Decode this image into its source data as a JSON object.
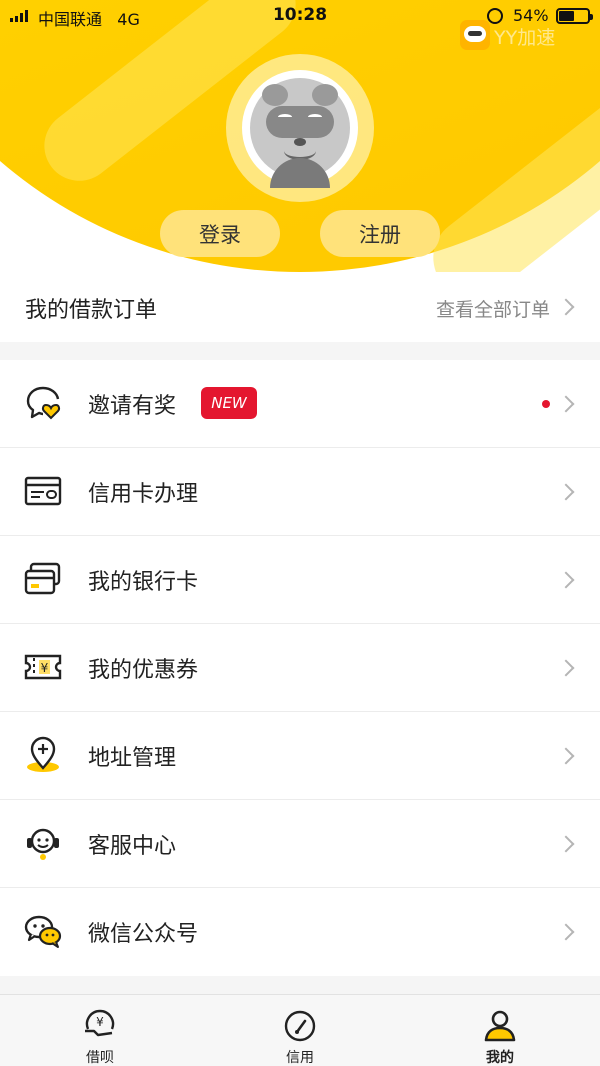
{
  "status_bar": {
    "carrier": "中国联通",
    "network": "4G",
    "time": "10:28",
    "battery": "54%",
    "battery_level": 0.54
  },
  "header": {
    "watermark": "YY加速",
    "login_label": "登录",
    "register_label": "注册"
  },
  "orders": {
    "title": "我的借款订单",
    "view_all": "查看全部订单"
  },
  "menu": {
    "items": [
      {
        "label": "邀请有奖",
        "icon": "invite-heart-icon",
        "badge": "NEW"
      },
      {
        "label": "信用卡办理",
        "icon": "credit-card-icon"
      },
      {
        "label": "我的银行卡",
        "icon": "bank-card-icon"
      },
      {
        "label": "我的优惠券",
        "icon": "coupon-icon"
      },
      {
        "label": "地址管理",
        "icon": "location-pin-icon"
      },
      {
        "label": "客服中心",
        "icon": "customer-service-icon"
      },
      {
        "label": "微信公众号",
        "icon": "wechat-icon"
      }
    ]
  },
  "tabbar": {
    "tabs": [
      {
        "label": "借呗",
        "icon": "loan-icon"
      },
      {
        "label": "信用",
        "icon": "credit-gauge-icon"
      },
      {
        "label": "我的",
        "icon": "profile-icon",
        "active": true
      }
    ]
  },
  "colors": {
    "brand_yellow": "#ffd000",
    "button_yellow": "#ffe27a",
    "badge_red": "#e4162f"
  }
}
